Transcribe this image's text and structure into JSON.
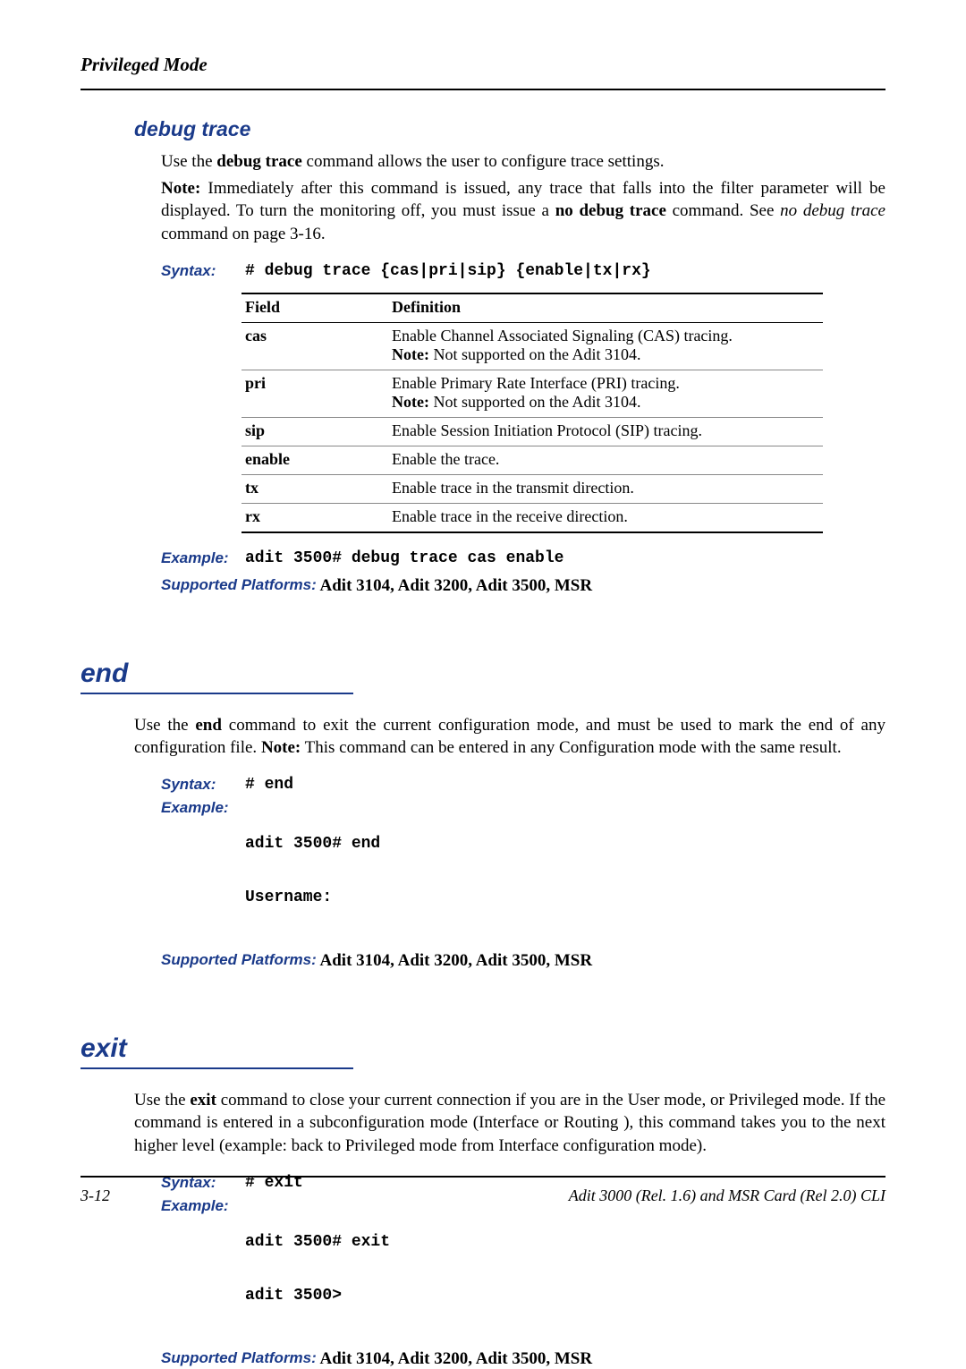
{
  "running_head": "Privileged Mode",
  "debug_trace": {
    "heading": "debug trace",
    "line1_a": "Use the ",
    "line1_b": "debug trace",
    "line1_c": " command allows the user to configure trace settings.",
    "note_label": "Note:",
    "note_body_a": " Immediately after this command is issued, any trace that falls into the filter parameter will be displayed. To turn the monitoring off, you must issue a ",
    "note_body_cmd": "no debug trace",
    "note_body_b": " command. See ",
    "note_body_ref": "no debug trace",
    "note_body_c": " command on page 3-16.",
    "syntax_label": "Syntax:",
    "syntax_code": "# debug trace {cas|pri|sip} {enable|tx|rx}",
    "table_headers": {
      "field": "Field",
      "definition": "Definition"
    },
    "table_rows": [
      {
        "field": "cas",
        "def": "Enable Channel Associated Signaling (CAS) tracing.",
        "note_label": "Note:",
        "note": " Not supported on the Adit 3104."
      },
      {
        "field": "pri",
        "def": "Enable Primary Rate Interface (PRI) tracing.",
        "note_label": "Note:",
        "note": " Not supported on the Adit 3104."
      },
      {
        "field": "sip",
        "def": "Enable Session Initiation Protocol (SIP) tracing."
      },
      {
        "field": "enable",
        "def": "Enable the trace."
      },
      {
        "field": "tx",
        "def": "Enable trace in the transmit direction."
      },
      {
        "field": "rx",
        "def": "Enable trace in the receive direction."
      }
    ],
    "example_label": "Example:",
    "example_code": "adit 3500# debug trace cas enable",
    "platforms_label": "Supported Platforms:",
    "platforms": "  Adit 3104, Adit 3200, Adit 3500, MSR"
  },
  "end": {
    "heading": "end",
    "para_a": "Use the ",
    "para_b": "end",
    "para_c": " command to exit the current configuration mode, and must be used to mark the end of any configuration file. ",
    "para_note_label": "Note:",
    "para_d": " This command can be entered in any Configuration mode with the same result.",
    "syntax_label": "Syntax:",
    "syntax_code": "# end",
    "example_label": "Example:",
    "example_code_l1": "adit 3500# end",
    "example_code_l2": "Username:",
    "platforms_label": "Supported Platforms:",
    "platforms": "  Adit 3104, Adit 3200, Adit 3500, MSR"
  },
  "exit": {
    "heading": "exit",
    "para_a": "Use the ",
    "para_b": "exit",
    "para_c": " command to close your current connection if you are in the User mode, or Privileged mode. If the command is entered in a subconfiguration mode (Interface or Routing ), this command takes you to the next higher level (example: back to Privileged mode from Interface configuration mode).",
    "syntax_label": "Syntax:",
    "syntax_code": "# exit",
    "example_label": "Example:",
    "example_code_l1": "adit 3500# exit",
    "example_code_l2": "adit 3500>",
    "platforms_label": "Supported Platforms:",
    "platforms": "  Adit 3104, Adit 3200, Adit 3500, MSR"
  },
  "footer": {
    "page": "3-12",
    "title": "Adit 3000 (Rel. 1.6) and MSR Card (Rel 2.0) CLI"
  }
}
